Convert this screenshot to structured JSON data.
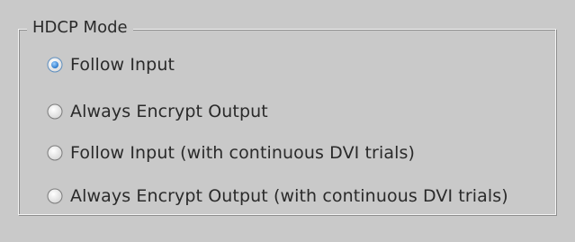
{
  "group": {
    "title": "HDCP Mode",
    "options": [
      {
        "label": "Follow Input",
        "selected": true
      },
      {
        "label": "Always Encrypt Output",
        "selected": false
      },
      {
        "label": "Follow Input (with continuous DVI trials)",
        "selected": false
      },
      {
        "label": "Always Encrypt Output (with continuous DVI trials)",
        "selected": false
      }
    ]
  },
  "colors": {
    "background": "#c9c9c9",
    "text": "#2a2a2a",
    "radio_selected": "#2f7fd6"
  }
}
